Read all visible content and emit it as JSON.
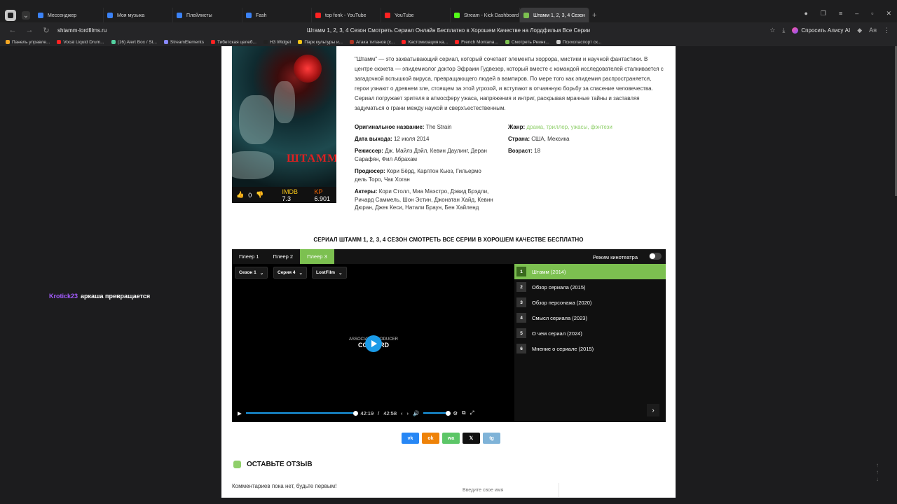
{
  "browser": {
    "tabs": [
      {
        "label": "Мессенджер",
        "color": "#3b82f6"
      },
      {
        "label": "Моя музыка",
        "color": "#3b82f6"
      },
      {
        "label": "Плейлисты",
        "color": "#3b82f6"
      },
      {
        "label": "Fash",
        "color": "#3b82f6"
      },
      {
        "label": "top fonk - YouTube",
        "color": "#ff2222"
      },
      {
        "label": "YouTube",
        "color": "#ff2222"
      },
      {
        "label": "Stream - Kick Dashboard",
        "color": "#53fc18"
      },
      {
        "label": "Штамм 1, 2, 3, 4 Сезон",
        "color": "#7cc050",
        "active": true
      }
    ],
    "url": "shtamm-lordfilms.ru",
    "page_title": "Штамм 1, 2, 3, 4 Сезон Смотреть Сериал Онлайн Бесплатно в Хорошем Качестве на Лордфильм Все Серии",
    "alice_label": "Спросить Алису AI",
    "bookmarks": [
      {
        "label": "Панель управле...",
        "color": "#f5a623"
      },
      {
        "label": "Vocal Liquid Drum...",
        "color": "#ff2222"
      },
      {
        "label": "(16) Alert Box / St...",
        "color": "#53d1a0"
      },
      {
        "label": "StreamElements",
        "color": "#8888ff"
      },
      {
        "label": "Тибетская целеб...",
        "color": "#ff2222"
      },
      {
        "label": "H3 Widget",
        "color": "#222222"
      },
      {
        "label": "Парк культуры и...",
        "color": "#f5c518"
      },
      {
        "label": "Атака титанов (с...",
        "color": "#aa3322"
      },
      {
        "label": "Кастомизация ка...",
        "color": "#ff2222"
      },
      {
        "label": "French Montana...",
        "color": "#ff2222"
      },
      {
        "label": "Смотреть Реинк...",
        "color": "#7cc050"
      },
      {
        "label": "Психопаспорт ск...",
        "color": "#cccccc"
      }
    ]
  },
  "show": {
    "description": "\"Штамм\" — это захватывающий сериал, который сочетает элементы хоррора, мистики и научной фантастики. В центре сюжета — эпидемиолог доктор Эфраим Гудвезер, который вместе с командой исследователей сталкивается с загадочной вспышкой вируса, превращающего людей в вампиров. По мере того как эпидемия распространяется, герои узнают о древнем зле, стоящем за этой угрозой, и вступают в отчаянную борьбу за спасение человечества. Сериал погружает зрителя в атмосферу ужаса, напряжения и интриг, раскрывая мрачные тайны и заставляя задуматься о грани между наукой и сверхъестественным.",
    "poster_logo": "ШТАММ",
    "likes": "0",
    "imdb_label": "IMDB",
    "imdb": "7.3",
    "kp_label": "KP",
    "kp": "6.901",
    "original_name_label": "Оригинальное название:",
    "original_name": "The Strain",
    "release_label": "Дата выхода:",
    "release": "12 июля 2014",
    "directors_label": "Режиссер:",
    "directors": "Дж. Майлз Дэйл, Кевин Даулинг, Деран Сарафян, Фил Абрахам",
    "producers_label": "Продюсер:",
    "producers": "Кори Бёрд, Карлтон Кьюз, Гильермо дель Торо, Чак Хоган",
    "actors_label": "Актеры:",
    "actors": "Кори Столл, Миа Маэстро, Дэвид Брэдли, Ричард Саммель, Шон Эстин, Джонатан Хайд, Кевин Дюран, Джек Кеси, Натали Браун, Бен Хайленд",
    "genre_label": "Жанр:",
    "genres": "драма, триллер, ужасы, фэнтези",
    "country_label": "Страна:",
    "country": "США, Мексика",
    "age_label": "Возраст:",
    "age": "18"
  },
  "heading": "СЕРИАЛ ШТАММ 1, 2, 3, 4 СЕЗОН СМОТРЕТЬ ВСЕ СЕРИИ В ХОРОШЕМ КАЧЕСТВЕ БЕСПЛАТНО",
  "player": {
    "tabs": [
      "Плеер 1",
      "Плеер 2",
      "Плеер 3"
    ],
    "active_tab": 2,
    "cinema_label": "Режим кинотеатра",
    "season": "Сезон 1",
    "episode": "Серия 4",
    "voice": "LostFilm",
    "frame_text_top": "ASSOCIATE PRODUCER",
    "frame_text_name": "COLLARD",
    "time_current": "42:19",
    "time_sep": "/",
    "time_total": "42:58",
    "progress": 0.985,
    "volume": 0.9,
    "episodes": [
      {
        "n": "1",
        "title": "Штамм (2014)"
      },
      {
        "n": "2",
        "title": "Обзор сериала (2015)"
      },
      {
        "n": "3",
        "title": "Обзор персонажа (2020)"
      },
      {
        "n": "4",
        "title": "Смысл сериала (2023)"
      },
      {
        "n": "5",
        "title": "О чем сериал (2024)"
      },
      {
        "n": "6",
        "title": "Мнение о сериале (2015)"
      }
    ]
  },
  "share": [
    {
      "label": "vk",
      "color": "#2787f5"
    },
    {
      "label": "ok",
      "color": "#ee8208"
    },
    {
      "label": "wa",
      "color": "#5cc667"
    },
    {
      "label": "𝕏",
      "color": "#111111"
    },
    {
      "label": "tg",
      "color": "#7fb3d8"
    }
  ],
  "review": {
    "title": "ОСТАВЬТЕ ОТЗЫВ",
    "no_comments": "Комментариев пока нет, будьте первым!",
    "name_placeholder": "Введите свое имя"
  },
  "chat": {
    "user": "Krotick23",
    "message": "аркаша превращается"
  }
}
